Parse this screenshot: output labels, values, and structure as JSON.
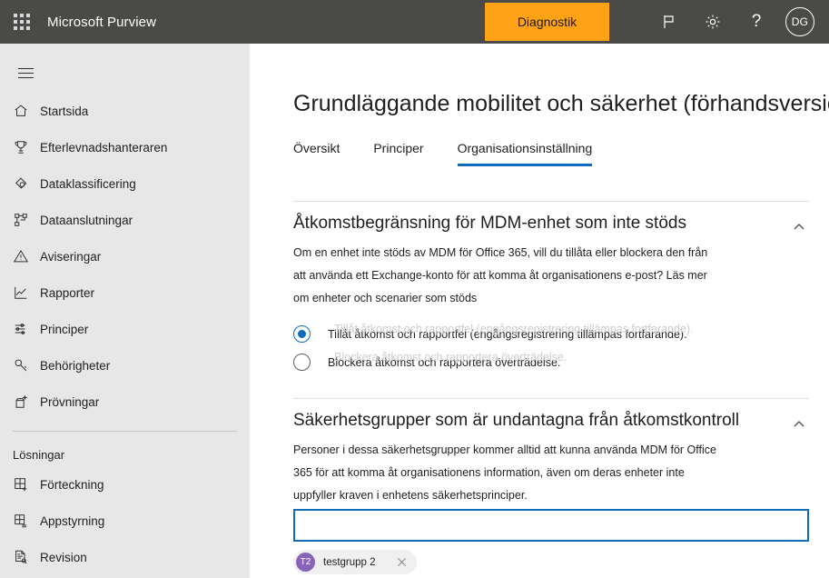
{
  "suitebar": {
    "waffle_label": "app-launcher",
    "title": "Microsoft Purview",
    "diagnostik_label": "Diagnostik",
    "flag_label": "feedback",
    "gear_label": "settings",
    "help_label": "?",
    "avatar_initials": "DG",
    "background": "#4a4a48",
    "accent_orange": "#ffa216"
  },
  "sidebar": {
    "items": [
      {
        "label": "Startsida",
        "icon": "home-icon"
      },
      {
        "label": "Efterlevnadshanteraren",
        "icon": "trophy-icon"
      },
      {
        "label": "Dataklassificering",
        "icon": "tag-icon"
      },
      {
        "label": "Dataanslutningar",
        "icon": "hierarchy-icon"
      },
      {
        "label": "Aviseringar",
        "icon": "warning-triangle-icon"
      },
      {
        "label": "Rapporter",
        "icon": "line-chart-icon"
      },
      {
        "label": "Principer",
        "icon": "sliders-icon"
      },
      {
        "label": "Behörigheter",
        "icon": "key-icon"
      },
      {
        "label": "Prövningar",
        "icon": "trial-box-icon"
      }
    ],
    "group_title": "Lösningar",
    "group_items": [
      {
        "label": "Förteckning",
        "icon": "catalog-add-icon"
      },
      {
        "label": "Appstyrning",
        "icon": "app-governance-icon"
      },
      {
        "label": "Revision",
        "icon": "audit-doc-icon"
      }
    ],
    "background": "#e7e7e7"
  },
  "main": {
    "page_title": "Grundläggande mobilitet och säkerhet (förhandsversion)",
    "tabs": [
      {
        "label": "Översikt",
        "active": false
      },
      {
        "label": "Principer",
        "active": false
      },
      {
        "label": "Organisationsinställning",
        "active": true
      }
    ],
    "tab_accent": "#0f6cbd",
    "sections": [
      {
        "title": "Åtkomstbegränsning för MDM-enhet som inte stöds",
        "description": "Om en enhet inte stöds av MDM för Office 365, vill du tillåta eller blockera den från att använda ett Exchange-konto för att komma åt organisationens e-post? Läs mer om enheter och scenarier som stöds",
        "collapse_icon": "chevron-up-icon",
        "radios": [
          {
            "label": "Tillåt åtkomst och rapportfel (engångsregistrering tillämpas fortfarande).",
            "checked": true
          },
          {
            "label": "Blockera åtkomst och rapportera överträdelse.",
            "checked": false
          }
        ]
      },
      {
        "title": "Säkerhetsgrupper som är undantagna från åtkomstkontroll",
        "description": "Personer i dessa säkerhetsgrupper kommer alltid att kunna använda MDM för Office 365 för att komma åt organisationens information, även om deras enheter inte uppfyller kraven i enhetens säkerhetsprinciper.",
        "collapse_icon": "chevron-up-icon",
        "picker_value": "",
        "picker_placeholder": "",
        "chips": [
          {
            "initials": "T2",
            "label": "testgrupp 2",
            "avatar_color": "#8764b8",
            "remove_icon": "close-icon"
          }
        ]
      }
    ]
  }
}
